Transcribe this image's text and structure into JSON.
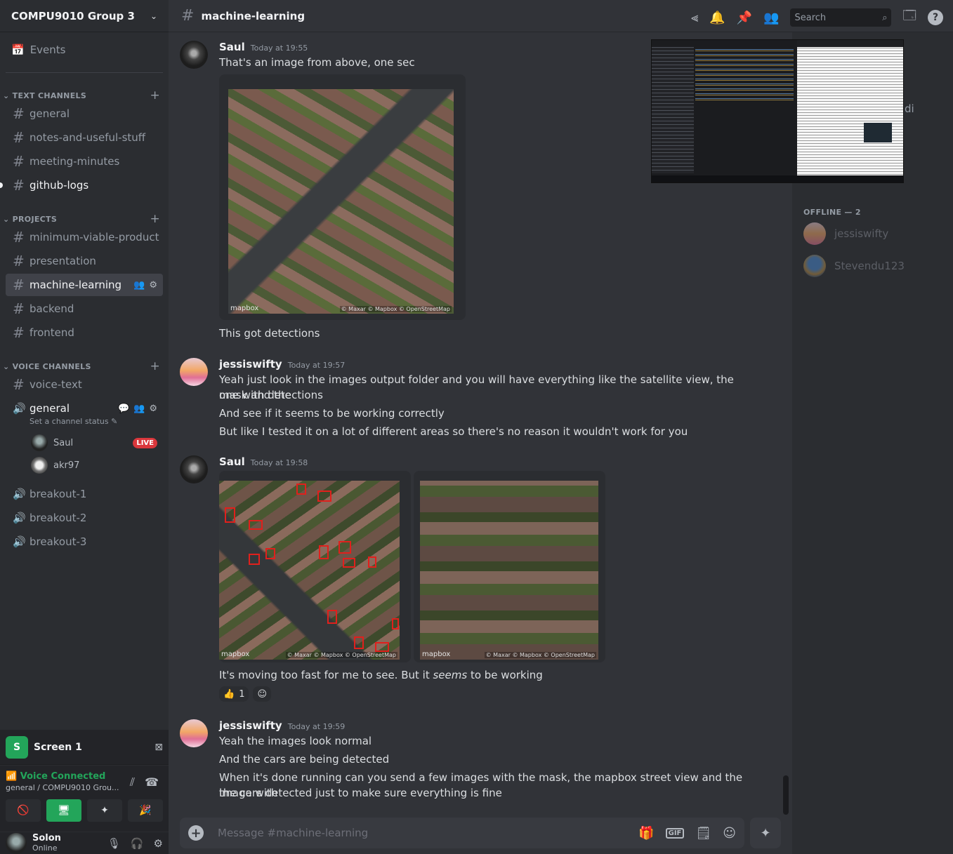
{
  "server": {
    "name": "COMPU9010 Group 3"
  },
  "sidebar": {
    "events_label": "Events",
    "categories": {
      "text": "TEXT CHANNELS",
      "projects": "PROJECTS",
      "voice": "VOICE CHANNELS"
    },
    "text_channels": [
      "general",
      "notes-and-useful-stuff",
      "meeting-minutes",
      "github-logs"
    ],
    "project_channels": [
      "minimum-viable-product",
      "presentation",
      "machine-learning",
      "backend",
      "frontend"
    ],
    "voice_channels": {
      "voice_text": "voice-text",
      "general": "general",
      "general_status": "Set a channel status",
      "users": [
        {
          "name": "Saul",
          "badge": "LIVE"
        },
        {
          "name": "akr97"
        }
      ],
      "breakouts": [
        "breakout-1",
        "breakout-2",
        "breakout-3"
      ]
    }
  },
  "screen_panel": {
    "badge": "S",
    "label": "Screen 1"
  },
  "voice_panel": {
    "status": "Voice Connected",
    "location": "general / COMPU9010 Grou..."
  },
  "user_panel": {
    "name": "Solon",
    "status": "Online"
  },
  "header": {
    "channel": "machine-learning",
    "search_placeholder": "Search"
  },
  "messages": [
    {
      "author": "Saul",
      "time": "Today at 19:55",
      "lines": [
        "That's an image from above, one sec"
      ],
      "after_image": "This got detections"
    },
    {
      "author": "jessiswifty",
      "time": "Today at 19:57",
      "lines": [
        "Yeah just look in the images output folder and you will have everything like the satellite view, the mask and the",
        "one with detections",
        "And see if it seems to be working correctly",
        "But like I tested it on a lot of different areas so there's no reason it wouldn't work for you"
      ]
    },
    {
      "author": "Saul",
      "time": "Today at 19:58",
      "text_before": "It's moving too fast for me to see. But it ",
      "text_em": "seems",
      "text_after": " to be working",
      "reaction": {
        "emoji": "👍",
        "count": "1"
      }
    },
    {
      "author": "jessiswifty",
      "time": "Today at 19:59",
      "lines": [
        "Yeah the images look normal",
        "And the cars are being detected",
        "When it's done running can you send a few images with the mask, the mapbox street view and the image with",
        "the cars detected just to make sure everything is fine"
      ]
    }
  ],
  "image_overlay": {
    "logo": "mapbox",
    "credit": "© Maxar © Mapbox © OpenStreetMap"
  },
  "composer": {
    "placeholder": "Message #machine-learning",
    "gif_label": "GIF"
  },
  "members": {
    "offline_header": "OFFLINE — 2",
    "offline": [
      "jessiswifty",
      "Stevendu123"
    ],
    "partial_text": "di"
  }
}
